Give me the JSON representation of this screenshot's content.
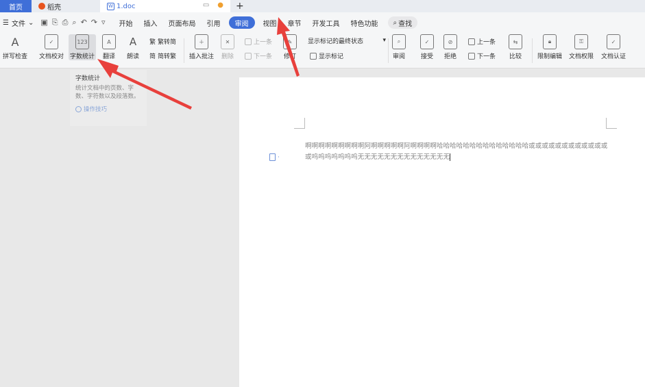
{
  "tabbar": {
    "home": "首页",
    "daoke": "稻壳",
    "doc": "1.doc",
    "add": "+"
  },
  "menu": {
    "file": "文件",
    "items": [
      "开始",
      "插入",
      "页面布局",
      "引用",
      "审阅",
      "视图",
      "章节",
      "开发工具",
      "特色功能"
    ],
    "active": "审阅",
    "search": "查找"
  },
  "ribbon": {
    "spellcheck": "拼写检查",
    "doc_proof": "文档校对",
    "word_count": "字数统计",
    "translate": "翻译",
    "read_aloud": "朗读",
    "trad_simp": "繁转简",
    "simp_trad": "简转繁",
    "insert_comment": "插入批注",
    "delete": "删除",
    "prev_item": "上一条",
    "next_item": "下一条",
    "revise": "修订",
    "markup_state": "显示标记的最终状态",
    "show_markup": "显示标记",
    "review": "审阅",
    "accept": "接受",
    "reject": "拒绝",
    "prev_change": "上一条",
    "next_change": "下一条",
    "compare": "比较",
    "restrict_edit": "限制编辑",
    "doc_permission": "文档权限",
    "doc_auth": "文档认证"
  },
  "tooltip": {
    "title": "字数统计",
    "desc": "统计文档中的页数、字数、字符数以及段落数。",
    "link": "操作技巧"
  },
  "document": {
    "text": "啊啊啊啊啊啊啊啊啊阿啊啊啊啊啊阿啊啊啊啊哈哈哈哈哈哈哈哈哈哈哈哈哈哈或或或或或或或或或或或或或呜呜呜呜呜呜呜无无无无无无无无无无无无无无"
  },
  "colors": {
    "accent": "#3f6fd8",
    "arrow": "#e8403c"
  }
}
